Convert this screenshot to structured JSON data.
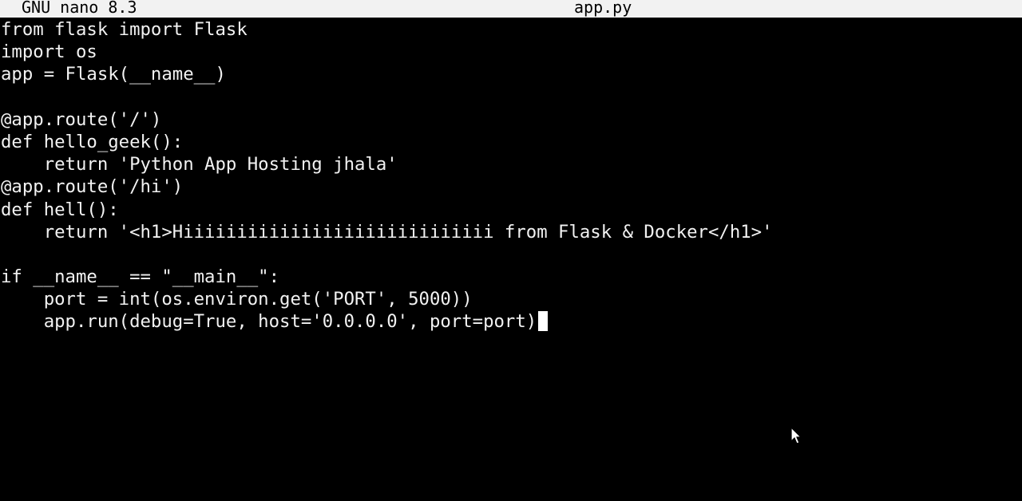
{
  "titlebar": {
    "version": "GNU nano 8.3",
    "filename": "app.py"
  },
  "editor": {
    "lines": [
      "from flask import Flask",
      "import os",
      "app = Flask(__name__)",
      "",
      "@app.route('/')",
      "def hello_geek():",
      "    return 'Python App Hosting jhala'",
      "@app.route('/hi')",
      "def hell():",
      "    return '<h1>Hiiiiiiiiiiiiiiiiiiiiiiiiiiiii from Flask & Docker</h1>'",
      "",
      "if __name__ == \"__main__\":",
      "    port = int(os.environ.get('PORT', 5000))",
      "    app.run(debug=True, host='0.0.0.0', port=port)"
    ]
  },
  "colors": {
    "background": "#000000",
    "text": "#f2f2f2",
    "titlebar_bg": "#f2f2f2",
    "titlebar_text": "#000000"
  },
  "icons": {
    "pointer": "mouse-pointer-icon"
  }
}
